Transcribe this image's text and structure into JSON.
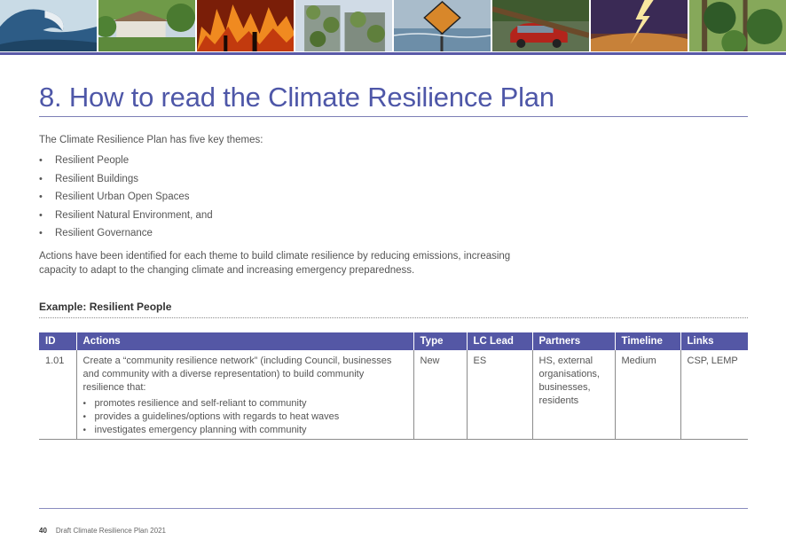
{
  "banner": {
    "images": [
      {
        "icon": "wave-image",
        "colors": [
          "#2d5c86",
          "#e8eef2"
        ]
      },
      {
        "icon": "house-garden-image",
        "colors": [
          "#5d8a3c",
          "#c8d6e0"
        ]
      },
      {
        "icon": "bushfire-image",
        "colors": [
          "#c23a0e",
          "#f08a20"
        ]
      },
      {
        "icon": "green-building-image",
        "colors": [
          "#6f8f4a",
          "#d0dbe6"
        ]
      },
      {
        "icon": "flood-sign-image",
        "colors": [
          "#6d8ea8",
          "#d8872a"
        ]
      },
      {
        "icon": "fallen-tree-car-image",
        "colors": [
          "#3f5a2f",
          "#b3241c"
        ]
      },
      {
        "icon": "lightning-storm-image",
        "colors": [
          "#3a2a55",
          "#f0a040"
        ]
      },
      {
        "icon": "forest-image",
        "colors": [
          "#2f5a28",
          "#86a85a"
        ]
      }
    ]
  },
  "page": {
    "title": "8. How to read the Climate Resilience Plan",
    "intro": "The Climate Resilience Plan has five key themes:",
    "themes": [
      "Resilient People",
      "Resilient Buildings",
      "Resilient Urban Open Spaces",
      "Resilient Natural Environment, and",
      "Resilient Governance"
    ],
    "bullet_glyph": "•",
    "paragraph": "Actions have been identified for each theme to build climate resilience by reducing emissions, increasing capacity to adapt to the changing climate and increasing emergency preparedness.",
    "example_heading": "Example: Resilient People"
  },
  "table": {
    "headers": {
      "id": "ID",
      "actions": "Actions",
      "type": "Type",
      "lc_lead": "LC Lead",
      "partners": "Partners",
      "timeline": "Timeline",
      "links": "Links"
    },
    "row": {
      "id": "1.01",
      "action_text": "Create a “community resilience network” (including Council, businesses and community with a diverse representation) to build community resilience that:",
      "action_points": [
        "promotes resilience and self-reliant to community",
        "provides a guidelines/options with regards to heat waves",
        "investigates emergency planning with community"
      ],
      "type": "New",
      "lc_lead": "ES",
      "partners": "HS, external organisations, businesses, residents",
      "timeline": "Medium",
      "links": "CSP, LEMP"
    }
  },
  "footer": {
    "page_number": "40",
    "doc_title": "Draft Climate Resilience Plan 2021"
  },
  "colors": {
    "accent": "#4e57a8",
    "header_fill": "#5457a5"
  }
}
